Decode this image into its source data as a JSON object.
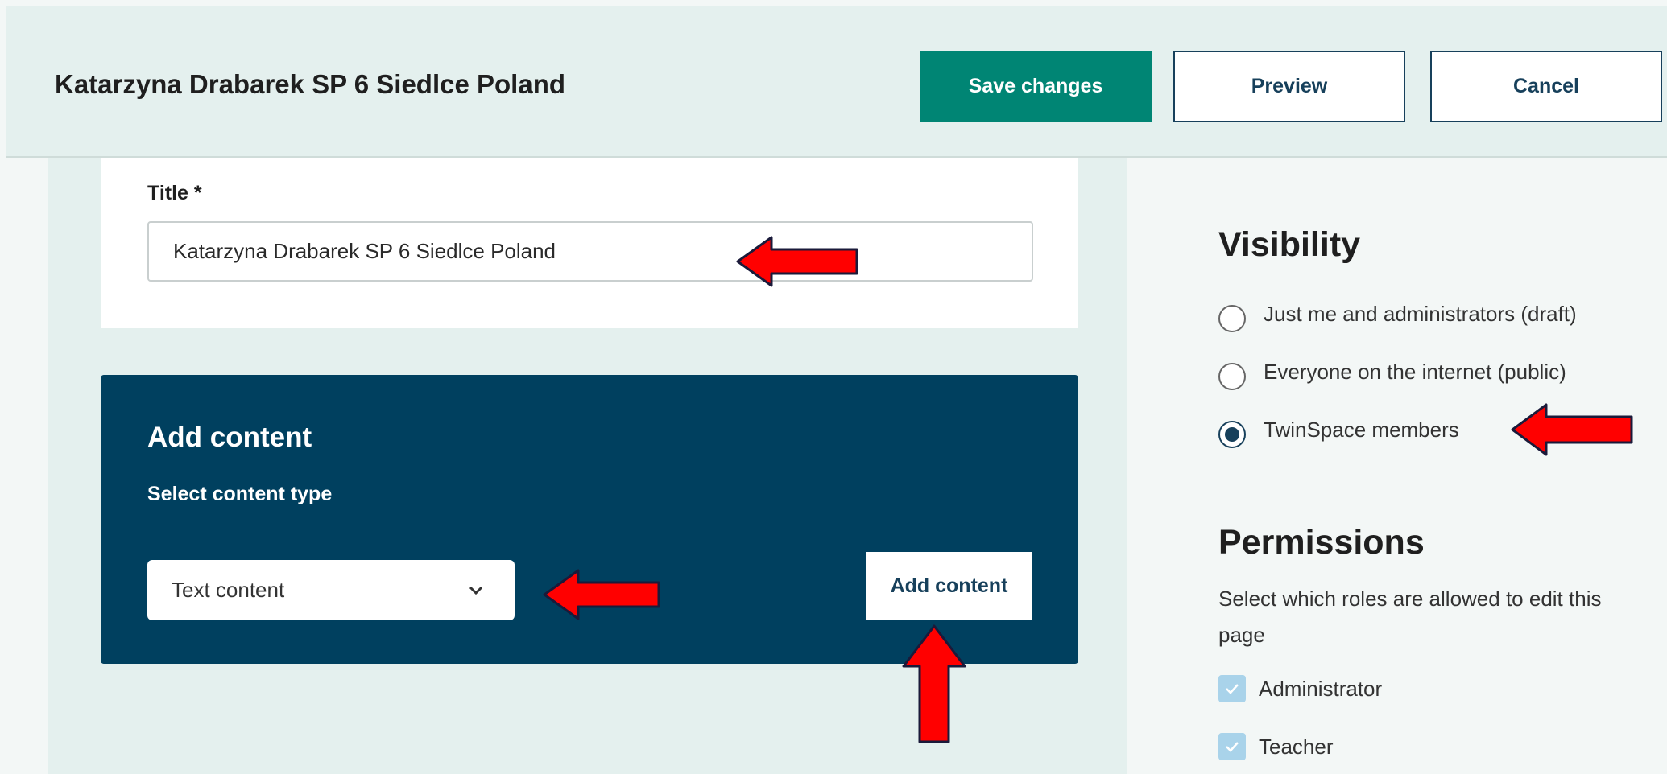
{
  "header": {
    "title": "Katarzyna Drabarek SP 6 Siedlce Poland",
    "save_label": "Save changes",
    "preview_label": "Preview",
    "cancel_label": "Cancel"
  },
  "title_field": {
    "label": "Title *",
    "value": "Katarzyna Drabarek SP 6 Siedlce Poland"
  },
  "add_content": {
    "heading": "Add content",
    "subheading": "Select content type",
    "selected_type": "Text content",
    "button_label": "Add content"
  },
  "visibility": {
    "heading": "Visibility",
    "options": [
      {
        "label": "Just me and administrators (draft)",
        "checked": false
      },
      {
        "label": "Everyone on the internet (public)",
        "checked": false
      },
      {
        "label": "TwinSpace members",
        "checked": true
      }
    ]
  },
  "permissions": {
    "heading": "Permissions",
    "description": "Select which roles are allowed to edit this page",
    "roles": [
      {
        "label": "Administrator",
        "checked": true
      },
      {
        "label": "Teacher",
        "checked": true
      }
    ]
  },
  "colors": {
    "primary_green": "#008574",
    "navy": "#00405f",
    "annotation_red": "#ff0000"
  },
  "icons": [
    "chevron-down-icon",
    "check-icon",
    "annotation-arrow"
  ]
}
